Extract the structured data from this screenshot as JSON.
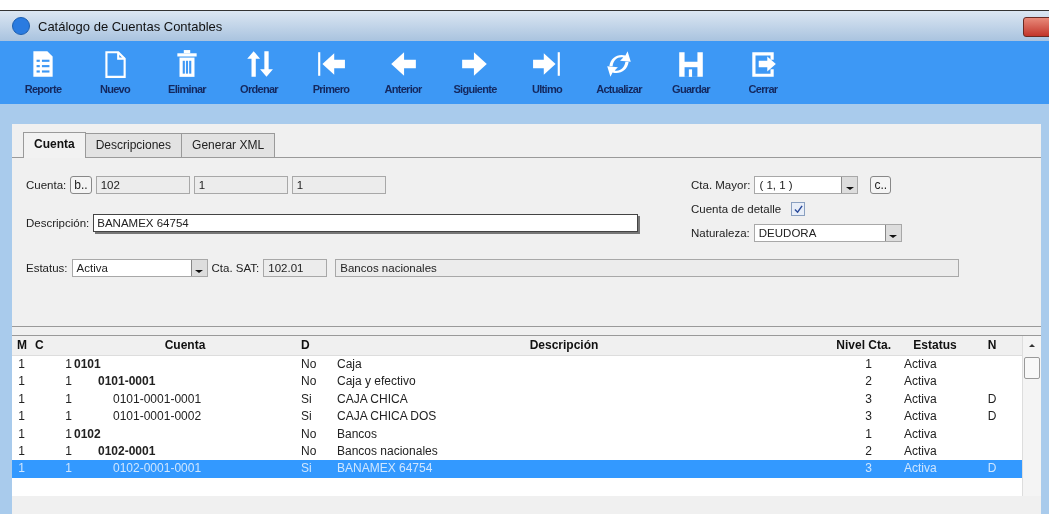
{
  "window": {
    "title": "Catálogo de Cuentas Contables"
  },
  "toolbar": [
    {
      "label": "Reporte",
      "kind": "report"
    },
    {
      "label": "Nuevo",
      "kind": "new"
    },
    {
      "label": "Eliminar",
      "kind": "delete"
    },
    {
      "label": "Ordenar",
      "kind": "sort"
    },
    {
      "label": "Primero",
      "kind": "first"
    },
    {
      "label": "Anterior",
      "kind": "prev"
    },
    {
      "label": "Siguiente",
      "kind": "next"
    },
    {
      "label": "Ultimo",
      "kind": "last"
    },
    {
      "label": "Actualizar",
      "kind": "refresh"
    },
    {
      "label": "Guardar",
      "kind": "save"
    },
    {
      "label": "Cerrar",
      "kind": "exit"
    }
  ],
  "tabs": [
    {
      "label": "Cuenta",
      "selected": true
    },
    {
      "label": "Descripciones",
      "selected": false
    },
    {
      "label": "Generar XML",
      "selected": false
    }
  ],
  "form": {
    "cuenta": {
      "label": "Cuenta:",
      "button": "b..",
      "segments": [
        "102",
        "1",
        "1"
      ]
    },
    "descripcion": {
      "label": "Descripción:",
      "value": "BANAMEX  64754"
    },
    "estatus": {
      "label": "Estatus:",
      "value": "Activa"
    },
    "cta_sat": {
      "label": "Cta. SAT:",
      "code": "102.01",
      "name": "Bancos nacionales"
    },
    "cta_mayor": {
      "label": "Cta. Mayor:",
      "value": "( 1, 1 )",
      "button": "c.."
    },
    "cuenta_detalle": {
      "label": "Cuenta de detalle",
      "checked": true
    },
    "naturaleza": {
      "label": "Naturaleza:",
      "value": "DEUDORA"
    }
  },
  "table": {
    "columns": [
      "M",
      "C",
      "Cuenta",
      "D",
      "Descripción",
      "Nivel Cta.",
      "Estatus",
      "N"
    ],
    "rows": [
      {
        "m": "1",
        "c": "1",
        "cuenta": "0101",
        "d": "No",
        "descripcion": "Caja",
        "nivel": "1",
        "estatus": "Activa",
        "selected": false,
        "children": [
          {
            "m": "1",
            "c": "1",
            "cuenta": "0101-0001",
            "d": "No",
            "descripcion": "Caja y efectivo",
            "nivel": "2",
            "estatus": "Activa",
            "selected": false,
            "children": [
              {
                "m": "1",
                "c": "1",
                "cuenta": "0101-0001-0001",
                "d": "Si",
                "descripcion": "CAJA CHICA",
                "nivel": "3",
                "estatus": "Activa",
                "n": "D",
                "selected": false
              },
              {
                "m": "1",
                "c": "1",
                "cuenta": "0101-0001-0002",
                "d": "Si",
                "descripcion": "CAJA CHICA DOS",
                "nivel": "3",
                "estatus": "Activa",
                "n": "D",
                "selected": false
              }
            ]
          }
        ]
      },
      {
        "m": "1",
        "c": "1",
        "cuenta": "0102",
        "d": "No",
        "descripcion": "Bancos",
        "nivel": "1",
        "estatus": "Activa",
        "selected": false,
        "children": [
          {
            "m": "1",
            "c": "1",
            "cuenta": "0102-0001",
            "d": "No",
            "descripcion": "Bancos nacionales",
            "nivel": "2",
            "estatus": "Activa",
            "selected": false,
            "children": [
              {
                "m": "1",
                "c": "1",
                "cuenta": "0102-0001-0001",
                "d": "Si",
                "descripcion": "BANAMEX  64754",
                "nivel": "3",
                "estatus": "Activa",
                "n": "D",
                "selected": true
              }
            ]
          }
        ]
      }
    ]
  }
}
